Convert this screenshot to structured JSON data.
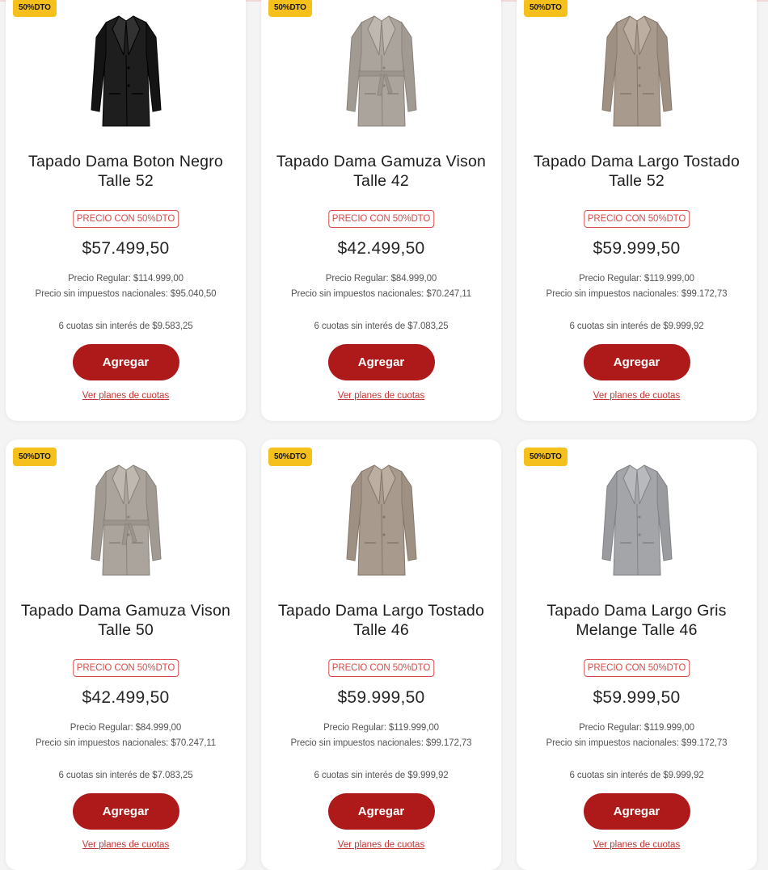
{
  "products": [
    {
      "badge": "50%DTO",
      "title": "Tapado Dama Boton Negro Talle 52",
      "promo_label": "PRECIO CON 50%DTO",
      "price": "$57.499,50",
      "regular_price": "Precio Regular: $114.999,00",
      "no_tax_price": "Precio sin impuestos nacionales: $95.040,50",
      "installments": "6 cuotas sin interés de $9.583,25",
      "add_label": "Agregar",
      "plans_label": "Ver planes de cuotas",
      "coat_color": "#1e1e1e",
      "coat_style": "plain"
    },
    {
      "badge": "50%DTO",
      "title": "Tapado Dama Gamuza Vison Talle 42",
      "promo_label": "PRECIO CON 50%DTO",
      "price": "$42.499,50",
      "regular_price": "Precio Regular: $84.999,00",
      "no_tax_price": "Precio sin impuestos nacionales: $70.247,11",
      "installments": "6 cuotas sin interés de $7.083,25",
      "add_label": "Agregar",
      "plans_label": "Ver planes de cuotas",
      "coat_color": "#aaa49c",
      "coat_style": "belted"
    },
    {
      "badge": "50%DTO",
      "title": "Tapado Dama Largo Tostado Talle 52",
      "promo_label": "PRECIO CON 50%DTO",
      "price": "$59.999,50",
      "regular_price": "Precio Regular: $119.999,00",
      "no_tax_price": "Precio sin impuestos nacionales: $99.172,73",
      "installments": "6 cuotas sin interés de $9.999,92",
      "add_label": "Agregar",
      "plans_label": "Ver planes de cuotas",
      "coat_color": "#a89a8c",
      "coat_style": "plain"
    },
    {
      "badge": "50%DTO",
      "title": "Tapado Dama Gamuza Vison Talle 50",
      "promo_label": "PRECIO CON 50%DTO",
      "price": "$42.499,50",
      "regular_price": "Precio Regular: $84.999,00",
      "no_tax_price": "Precio sin impuestos nacionales: $70.247,11",
      "installments": "6 cuotas sin interés de $7.083,25",
      "add_label": "Agregar",
      "plans_label": "Ver planes de cuotas",
      "coat_color": "#aaa49c",
      "coat_style": "belted"
    },
    {
      "badge": "50%DTO",
      "title": "Tapado Dama Largo Tostado Talle 46",
      "promo_label": "PRECIO CON 50%DTO",
      "price": "$59.999,50",
      "regular_price": "Precio Regular: $119.999,00",
      "no_tax_price": "Precio sin impuestos nacionales: $99.172,73",
      "installments": "6 cuotas sin interés de $9.999,92",
      "add_label": "Agregar",
      "plans_label": "Ver planes de cuotas",
      "coat_color": "#a89a8c",
      "coat_style": "plain"
    },
    {
      "badge": "50%DTO",
      "title": "Tapado Dama Largo Gris Melange Talle 46",
      "promo_label": "PRECIO CON 50%DTO",
      "price": "$59.999,50",
      "regular_price": "Precio Regular: $119.999,00",
      "no_tax_price": "Precio sin impuestos nacionales: $99.172,73",
      "installments": "6 cuotas sin interés de $9.999,92",
      "add_label": "Agregar",
      "plans_label": "Ver planes de cuotas",
      "coat_color": "#a3a5a8",
      "coat_style": "plain"
    }
  ],
  "colors": {
    "badge_bg": "#f6c01c",
    "button_bg": "#ae1a1a",
    "promo_border": "#d94a4a",
    "link": "#c23636"
  }
}
